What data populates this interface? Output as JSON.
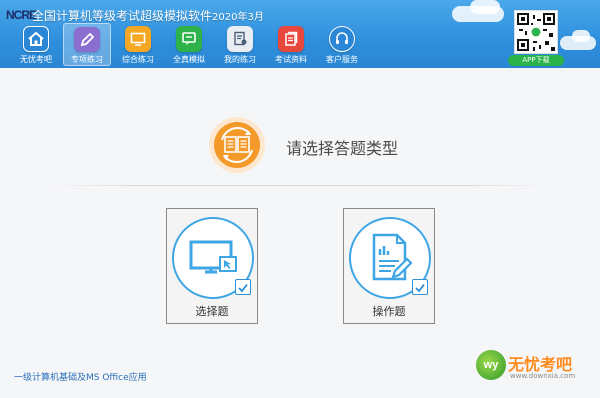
{
  "header": {
    "title": "全国计算机等级考试超级模拟软件",
    "year": "2020年3月",
    "logo_text": "NCRE"
  },
  "nav": {
    "items": [
      {
        "label": "无忧考吧",
        "icon": "home-icon",
        "color": "#2b87d6",
        "active": false
      },
      {
        "label": "专项练习",
        "icon": "pencil-icon",
        "color": "#8b6fd0",
        "active": true
      },
      {
        "label": "综合练习",
        "icon": "monitor-icon",
        "color": "#f5a623",
        "active": false
      },
      {
        "label": "全真模拟",
        "icon": "chat-screen-icon",
        "color": "#2db34a",
        "active": false
      },
      {
        "label": "我的练习",
        "icon": "document-user-icon",
        "color": "#e9eef5",
        "active": false
      },
      {
        "label": "考试资料",
        "icon": "files-icon",
        "color": "#e8473c",
        "active": false
      },
      {
        "label": "客户服务",
        "icon": "headset-icon",
        "color": "#2b87d6",
        "active": false
      }
    ]
  },
  "qr": {
    "label": "APP下载",
    "icon": "qr-code-icon"
  },
  "main": {
    "prompt": "请选择答题类型",
    "prompt_icon": "exchange-book-icon",
    "choices": [
      {
        "label": "选择题",
        "icon": "computer-screen-icon",
        "checked": true
      },
      {
        "label": "操作题",
        "icon": "document-edit-icon",
        "checked": true
      }
    ]
  },
  "footer": {
    "subject": "一级计算机基础及MS Office应用"
  },
  "watermark": {
    "logo": "wy",
    "name": "无忧考吧",
    "url": "www.downxia.com"
  },
  "colors": {
    "header_blue": "#2f8fdc",
    "accent_orange": "#f39a2b",
    "accent_blue": "#3fa6e6"
  }
}
